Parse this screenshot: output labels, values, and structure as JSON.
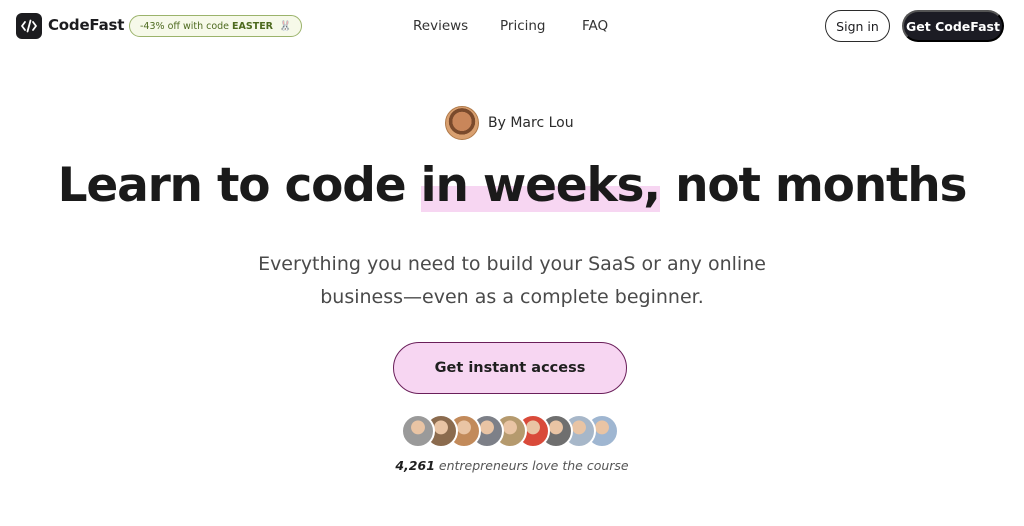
{
  "header": {
    "brand": "CodeFast",
    "promo": {
      "text": "-43% off with code",
      "code": "EASTER",
      "icon": "bunny-icon"
    },
    "nav": [
      {
        "label": "Reviews"
      },
      {
        "label": "Pricing"
      },
      {
        "label": "FAQ"
      }
    ],
    "signin_label": "Sign in",
    "cta_label": "Get CodeFast"
  },
  "hero": {
    "author": "By Marc Lou",
    "headline_pre": "Learn to code",
    "headline_highlight": "in weeks,",
    "headline_post": "not months",
    "subtitle_line1": "Everything you need to build your SaaS or any online",
    "subtitle_line2": "business—even as a complete beginner.",
    "cta_label": "Get instant access",
    "social_count": "4,261",
    "social_text": "entrepreneurs love the course"
  },
  "colors": {
    "highlight": "#f7d6f2",
    "dark": "#1c1c24",
    "promo_green": "#4d6a1f"
  },
  "avatars": [
    {
      "name": "customer-avatar-1",
      "color": "#9a9a9a"
    },
    {
      "name": "customer-avatar-2",
      "color": "#8b6b4e"
    },
    {
      "name": "customer-avatar-3",
      "color": "#c28a5a"
    },
    {
      "name": "customer-avatar-4",
      "color": "#7d8088"
    },
    {
      "name": "customer-avatar-5",
      "color": "#b59a6e"
    },
    {
      "name": "customer-avatar-6",
      "color": "#d94a3a"
    },
    {
      "name": "customer-avatar-7",
      "color": "#6f6f6f"
    },
    {
      "name": "customer-avatar-8",
      "color": "#a7b7c9"
    },
    {
      "name": "customer-avatar-9",
      "color": "#9fb6d1"
    }
  ]
}
